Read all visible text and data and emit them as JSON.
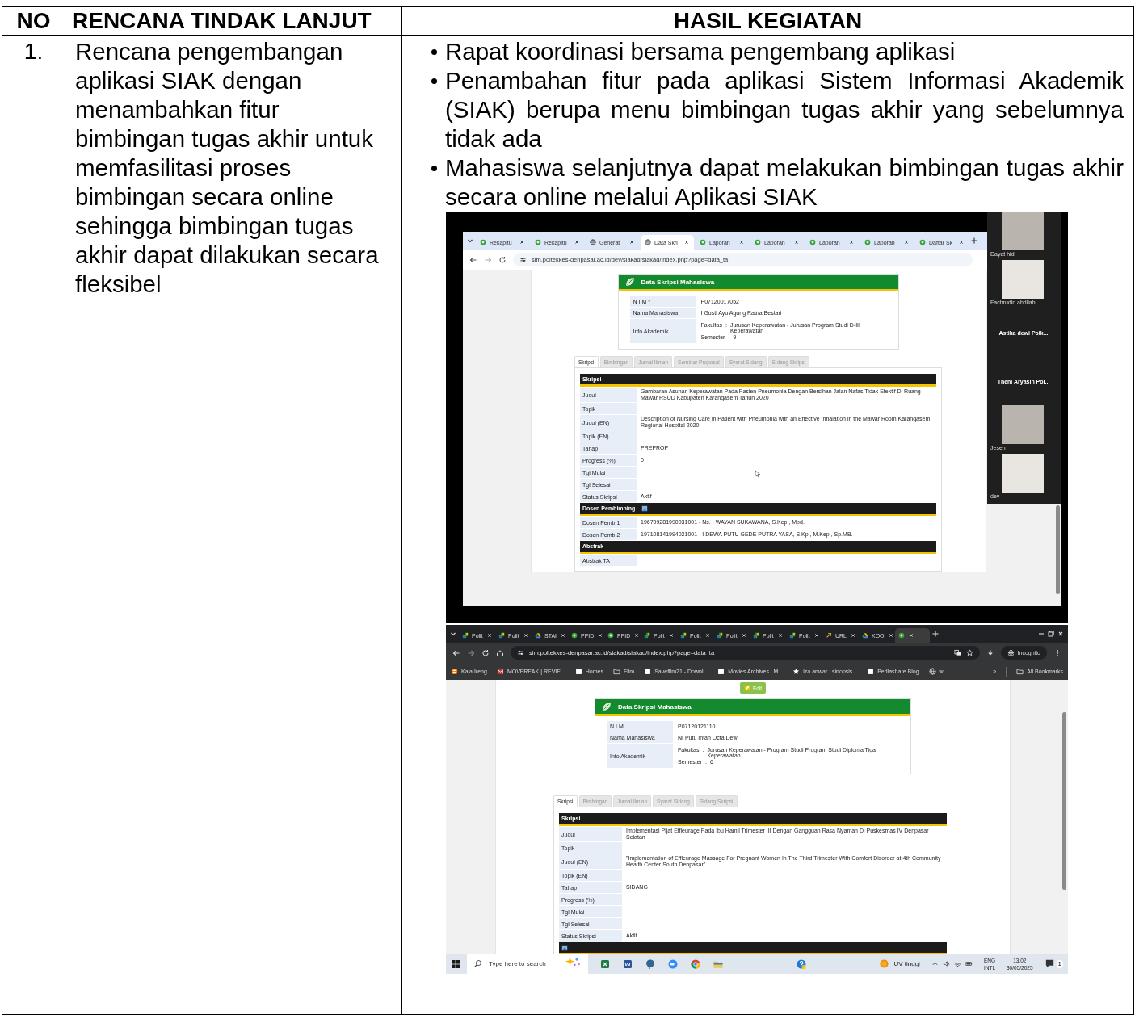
{
  "table": {
    "columns": [
      "NO",
      "RENCANA TINDAK LANJUT",
      "HASIL KEGIATAN"
    ],
    "rows": [
      {
        "no": "1.",
        "plan": "Rencana pengembangan aplikasi SIAK dengan menambahkan fitur bimbingan tugas akhir untuk memfasilitasi proses bimbingan secara online sehingga bimbingan tugas akhir dapat dilakukan secara fleksibel",
        "results": [
          "Rapat koordinasi bersama pengembang aplikasi",
          "Penambahan fitur pada aplikasi Sistem Informasi Akademik (SIAK) berupa menu bimbingan tugas akhir yang sebelumnya tidak ada",
          "Mahasiswa selanjutnya dapat melakukan bimbingan tugas akhir secara online melalui Aplikasi SIAK"
        ],
        "screenshots": [
          {
            "kind": "meeting_share",
            "tabs": [
              {
                "label": "Rekapitu",
                "kind": "badge",
                "selected": false
              },
              {
                "label": "Rekapitu",
                "kind": "badge",
                "selected": false
              },
              {
                "label": "Generat",
                "kind": "globe",
                "selected": false
              },
              {
                "label": "Data Skri",
                "kind": "globe",
                "selected": true
              },
              {
                "label": "Laporan",
                "kind": "badge",
                "selected": false
              },
              {
                "label": "Laporan",
                "kind": "badge",
                "selected": false
              },
              {
                "label": "Laporan",
                "kind": "badge",
                "selected": false
              },
              {
                "label": "Laporan",
                "kind": "badge",
                "selected": false
              },
              {
                "label": "Daftar Sk",
                "kind": "badge",
                "selected": false
              }
            ],
            "address": "sim.poltekkes-denpasar.ac.id/dev/siakad/siakad/index.php?page=data_ta",
            "page": {
              "title": "Data Skripsi Mahasiswa",
              "identity": [
                {
                  "label": "N I M *",
                  "value": "P07120017052"
                },
                {
                  "label": "Nama Mahasiswa",
                  "value": "I Gusti Ayu Agung Ratna Bestari"
                },
                {
                  "label": "Info Akademik",
                  "details": [
                    {
                      "label": "Fakultas",
                      "sep": ":",
                      "value": "Jurusan Keperawatan - Jurusan Program Studi D-III Keperawatan"
                    },
                    {
                      "label": "Semester",
                      "sep": ":",
                      "value": "9"
                    }
                  ]
                }
              ],
              "tabs": [
                {
                  "label": "Skripsi",
                  "selected": true
                },
                {
                  "label": "Bimbingan",
                  "selected": false
                },
                {
                  "label": "Jurnal Ilmiah",
                  "selected": false
                },
                {
                  "label": "Seminar Proposal",
                  "selected": false
                },
                {
                  "label": "Syarat Sidang",
                  "selected": false
                },
                {
                  "label": "Sidang Skripsi",
                  "selected": false
                }
              ],
              "sections": [
                {
                  "title": "Skripsi",
                  "rows": [
                    {
                      "label": "Judul",
                      "value": "Gambaran Asuhan Keperawatan Pada Pasien Pneumonia Dengan Bersihan Jalan Nafas Tidak Efektif Di Ruang Mawar RSUD Kabupaten Karangasem Tahun 2020"
                    },
                    {
                      "label": "Topik"
                    },
                    {
                      "label": "Judul (EN)",
                      "value": "Description of Nursing Care in Patient with Pneumonia with an Effective Inhalation in the Mawar Room Karangasem Regional Hospital 2020"
                    },
                    {
                      "label": "Topik (EN)"
                    },
                    {
                      "label": "Tahap",
                      "value": "PREPROP"
                    },
                    {
                      "label": "Progress (%)",
                      "value": "0"
                    },
                    {
                      "label": "Tgl Mulai"
                    },
                    {
                      "label": "Tgl Selesai"
                    },
                    {
                      "label": "Status Skripsi",
                      "value": "Aktif"
                    }
                  ]
                },
                {
                  "title": "Dosen Pembimbing",
                  "has_icon": true,
                  "rows": [
                    {
                      "label": "Dosen Pemb.1",
                      "value": "196709281990031001 - Ns. I WAYAN SUKAWANA, S.Kep., Mpd."
                    },
                    {
                      "label": "Dosen Pemb.2",
                      "value": "197108141994021001 - I DEWA PUTU GEDE PUTRA YASA, S.Kp., M.Kep., Sp.MB."
                    }
                  ]
                },
                {
                  "title": "Abstrak",
                  "rows": [
                    {
                      "label": "Abstrak TA"
                    }
                  ]
                }
              ]
            },
            "participants": [
              {
                "name": "Dayat hid",
                "kind": "video"
              },
              {
                "name": "Fachrudin abdilah",
                "kind": "video"
              },
              {
                "name": "Astika dewi  Polk...",
                "kind": "name"
              },
              {
                "name": "Theni  Aryasih Pol...",
                "kind": "name"
              },
              {
                "name": "Jesen",
                "kind": "video"
              },
              {
                "name": "dev",
                "kind": "video"
              }
            ]
          },
          {
            "kind": "desktop",
            "tabs": [
              {
                "label": "Polit",
                "kind": "leaf",
                "selected": false
              },
              {
                "label": "Polit",
                "kind": "leaf",
                "selected": false
              },
              {
                "label": "STAI",
                "kind": "drive",
                "selected": false
              },
              {
                "label": "PPID",
                "kind": "badge",
                "selected": false
              },
              {
                "label": "PPID",
                "kind": "badge",
                "selected": false
              },
              {
                "label": "Polit",
                "kind": "leaf",
                "selected": false
              },
              {
                "label": "Polit",
                "kind": "leaf",
                "selected": false
              },
              {
                "label": "Polit",
                "kind": "leaf",
                "selected": false
              },
              {
                "label": "Polit",
                "kind": "leaf",
                "selected": false
              },
              {
                "label": "Polit",
                "kind": "leaf",
                "selected": false
              },
              {
                "label": "URL",
                "kind": "link",
                "selected": false
              },
              {
                "label": "KOO",
                "kind": "drive",
                "selected": false
              },
              {
                "kind": "badge",
                "selected": true
              }
            ],
            "address": "sim.poltekkes-denpasar.ac.id/siakad/siakad/index.php?page=data_ta",
            "incognito": "Incognito",
            "bookmarks": [
              {
                "label": "Kala Ireng",
                "kind": "blogger"
              },
              {
                "label": "MOVFREAK | REVIE...",
                "kind": "site"
              },
              {
                "label": "Homes",
                "kind": "page"
              },
              {
                "label": "Film",
                "kind": "folder"
              },
              {
                "label": "Savefilm21 - Downl...",
                "kind": "page"
              },
              {
                "label": "Movies Archives | M...",
                "kind": "page"
              },
              {
                "label": "iza anwar : sinopsis...",
                "kind": "star"
              },
              {
                "label": "Pediashare Blog",
                "kind": "page"
              },
              {
                "label": "w",
                "kind": "globe"
              }
            ],
            "more": "»",
            "all_bookmarks": "All Bookmarks",
            "edit_button": "Edit",
            "page": {
              "title": "Data Skripsi Mahasiswa",
              "identity": [
                {
                  "label": "N I M",
                  "value": "P07120121110"
                },
                {
                  "label": "Nama Mahasiswa",
                  "value": "NI Putu Intan Octa Dewi"
                },
                {
                  "label": "Info Akademik",
                  "details": [
                    {
                      "label": "Fakultas",
                      "sep": ":",
                      "value": "Jurusan Keperawatan - Program Studi Program Studi Diploma Tiga Keperawatan"
                    },
                    {
                      "label": "Semester",
                      "sep": ":",
                      "value": "6"
                    }
                  ]
                }
              ],
              "tabs": [
                {
                  "label": "Skripsi",
                  "selected": true
                },
                {
                  "label": "Bimbingan",
                  "selected": false
                },
                {
                  "label": "Jurnal Ilmiah",
                  "selected": false
                },
                {
                  "label": "Syarat Sidang",
                  "selected": false
                },
                {
                  "label": "Sidang Skripsi",
                  "selected": false
                }
              ],
              "sections": [
                {
                  "title": "Skripsi",
                  "rows": [
                    {
                      "label": "Judul",
                      "value": "Implementasi Pijat Effleurage Pada Ibu Hamil Trimester III Dengan Gangguan Rasa Nyaman Di Puskesmas IV Denpasar Selatan"
                    },
                    {
                      "label": "Topik"
                    },
                    {
                      "label": "Judul (EN)",
                      "value": "\"Implementation of Effleurage Massage For Pregnant Women In The Third Trimester With Comfort Disorder at 4th Community Health Center South Denpasar\""
                    },
                    {
                      "label": "Topik (EN)"
                    },
                    {
                      "label": "Tahap",
                      "value": "SIDANG"
                    },
                    {
                      "label": "Progress (%)"
                    },
                    {
                      "label": "Tgl Mulai"
                    },
                    {
                      "label": "Tgl Selesai"
                    },
                    {
                      "label": "Status Skripsi",
                      "value": "Aktif"
                    }
                  ]
                },
                {
                  "has_icon": true
                }
              ]
            },
            "taskbar": {
              "search": "Type here to search",
              "weather": "UV tinggi",
              "lang": "ENG",
              "layout": "INTL",
              "time": "13.02",
              "date": "30/05/2025",
              "notifications": "1"
            }
          }
        ]
      }
    ]
  }
}
